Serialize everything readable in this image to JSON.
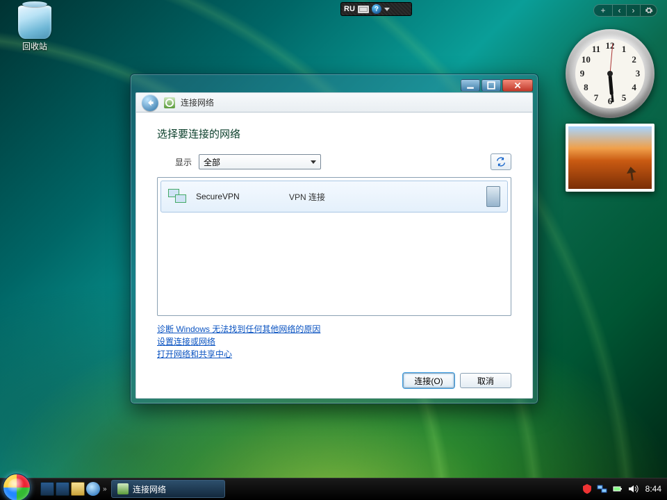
{
  "desktop": {
    "recycle_bin_label": "回收站"
  },
  "langbar": {
    "lang": "RU"
  },
  "clock": {
    "hour_angle": 175,
    "minute_angle": 174,
    "second_angle": 5,
    "numerals": [
      "12",
      "1",
      "2",
      "3",
      "4",
      "5",
      "6",
      "7",
      "8",
      "9",
      "10",
      "11"
    ]
  },
  "window": {
    "nav_title": "连接网络",
    "heading": "选择要连接的网络",
    "show_label": "显示",
    "show_value": "全部",
    "networks": [
      {
        "name": "SecureVPN",
        "type": "VPN 连接"
      }
    ],
    "links": {
      "diagnose": "诊断 Windows 无法找到任何其他网络的原因",
      "setup": "设置连接或网络",
      "center": "打开网络和共享中心"
    },
    "connect_btn": "连接(O)",
    "cancel_btn": "取消"
  },
  "taskbar": {
    "active_task": "连接网络",
    "time": "8:44"
  }
}
